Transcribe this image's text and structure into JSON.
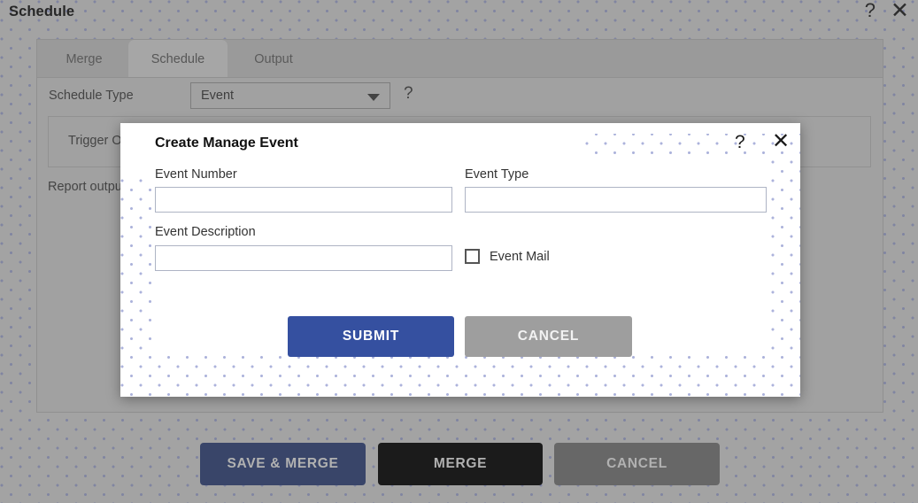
{
  "header": {
    "title": "Schedule",
    "help_icon": "question-mark-icon",
    "close_icon": "close-x-icon",
    "help_glyph": "?",
    "close_glyph": "✕"
  },
  "tabs": [
    {
      "id": "merge",
      "label": "Merge",
      "active": false
    },
    {
      "id": "schedule",
      "label": "Schedule",
      "active": true
    },
    {
      "id": "output",
      "label": "Output",
      "active": false
    }
  ],
  "schedule_form": {
    "schedule_type_label": "Schedule Type",
    "schedule_type_value": "Event",
    "schedule_type_options": [
      "Event"
    ],
    "help_glyph": "?",
    "trigger_label": "Trigger O",
    "report_output_label": "Report outpu"
  },
  "footer": {
    "save_merge_label": "SAVE & MERGE",
    "merge_label": "MERGE",
    "cancel_label": "CANCEL"
  },
  "modal": {
    "title": "Create Manage Event",
    "help_glyph": "?",
    "close_glyph": "✕",
    "fields": {
      "event_number_label": "Event Number",
      "event_number_value": "",
      "event_type_label": "Event Type",
      "event_type_value": "",
      "event_description_label": "Event Description",
      "event_description_value": "",
      "event_mail_label": "Event Mail",
      "event_mail_checked": false
    },
    "submit_label": "SUBMIT",
    "cancel_label": "CANCEL"
  },
  "colors": {
    "accent_blue": "#3550a0",
    "footer_navy": "#2b3d70",
    "footer_black": "#000000",
    "grey_button": "#9e9e9e",
    "panel_grey": "#c0c0c0",
    "backdrop_grey": "#c3c3c3",
    "dot_blue": "#6874be"
  }
}
